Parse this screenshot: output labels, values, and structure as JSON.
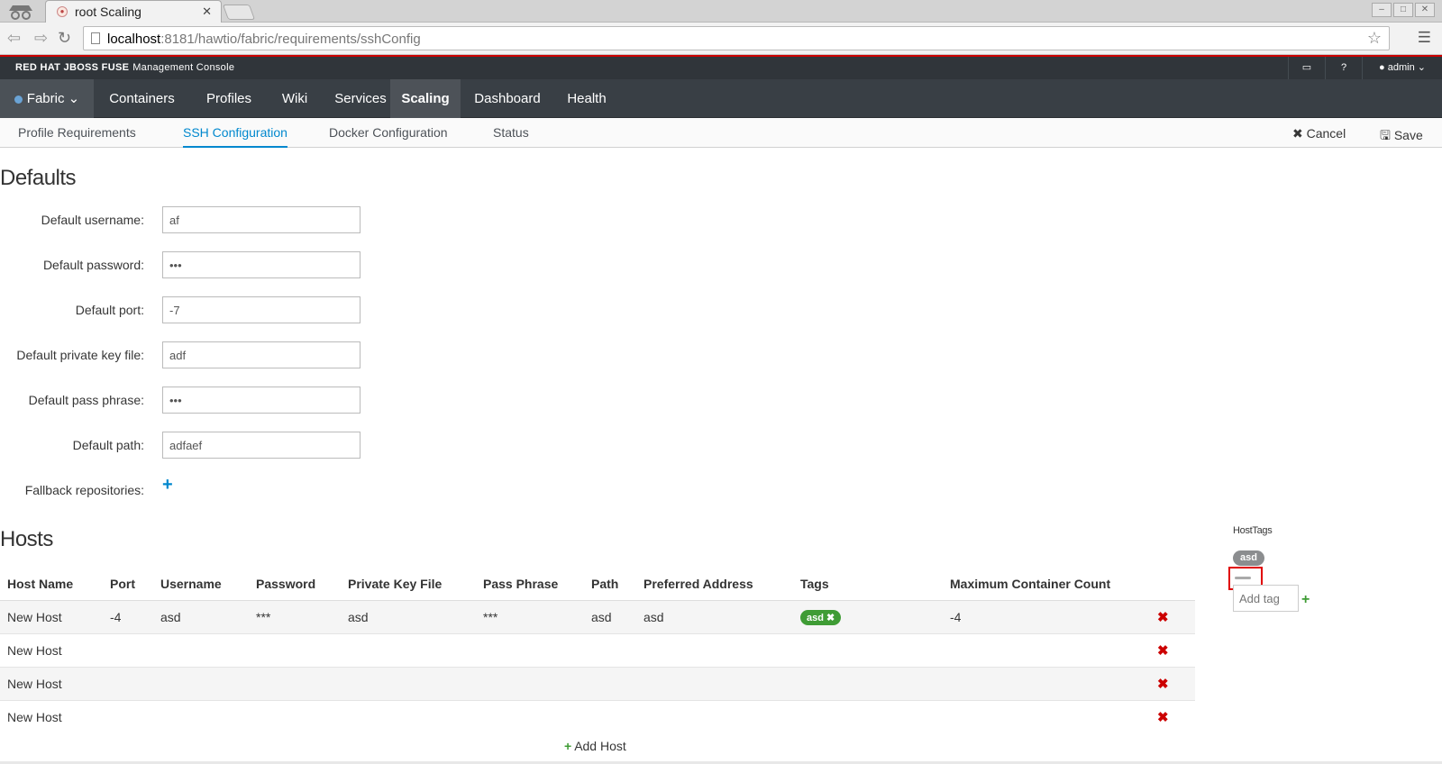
{
  "browser": {
    "tab_title": "root Scaling",
    "tab_close": "✕",
    "url_host": "localhost",
    "url_rest": ":8181/hawtio/fabric/requirements/sshConfig"
  },
  "header": {
    "brand": "RED HAT JBOSS FUSE",
    "brand_sub": "Management Console",
    "user": "admin"
  },
  "mainnav": {
    "fabric": "Fabric",
    "items": [
      "Containers",
      "Profiles",
      "Wiki",
      "Services",
      "Scaling",
      "Dashboard",
      "Health"
    ]
  },
  "subnav": {
    "items": [
      "Profile Requirements",
      "SSH Configuration",
      "Docker Configuration",
      "Status"
    ],
    "cancel": "Cancel",
    "save": "Save"
  },
  "defaults": {
    "heading": "Defaults",
    "fields": [
      {
        "label": "Default username:",
        "value": "af"
      },
      {
        "label": "Default password:",
        "value": "•••"
      },
      {
        "label": "Default port:",
        "value": "-7"
      },
      {
        "label": "Default private key file:",
        "value": "adf"
      },
      {
        "label": "Default pass phrase:",
        "value": "•••"
      },
      {
        "label": "Default path:",
        "value": "adfaef"
      }
    ],
    "fallback_label": "Fallback repositories:"
  },
  "hosts": {
    "heading": "Hosts",
    "columns": [
      "Host Name",
      "Port",
      "Username",
      "Password",
      "Private Key File",
      "Pass Phrase",
      "Path",
      "Preferred Address",
      "Tags",
      "Maximum Container Count"
    ],
    "rows": [
      {
        "name": "New Host",
        "port": "-4",
        "username": "asd",
        "password": "***",
        "key": "asd",
        "phrase": "***",
        "path": "asd",
        "address": "asd",
        "tag": "asd",
        "max": "-4"
      },
      {
        "name": "New Host"
      },
      {
        "name": "New Host"
      },
      {
        "name": "New Host"
      }
    ],
    "add_host": "Add Host"
  },
  "host_tags": {
    "title": "HostTags",
    "tag": "asd",
    "add_placeholder": "Add tag"
  },
  "colors": {
    "accent": "#0088ce",
    "success": "#3f9c35",
    "danger": "#cc0000",
    "nav_bg": "#393f45"
  }
}
